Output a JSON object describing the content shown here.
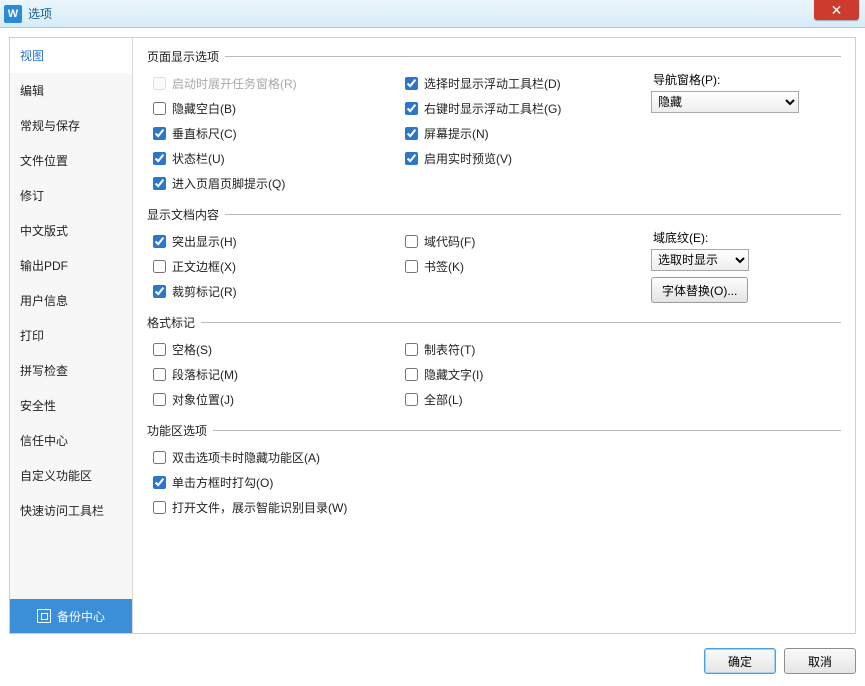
{
  "titlebar": {
    "title": "选项",
    "close": "✕",
    "app_icon_text": "W"
  },
  "sidebar": {
    "items": [
      "视图",
      "编辑",
      "常规与保存",
      "文件位置",
      "修订",
      "中文版式",
      "输出PDF",
      "用户信息",
      "打印",
      "拼写检查",
      "安全性",
      "信任中心",
      "自定义功能区",
      "快速访问工具栏"
    ],
    "selected_index": 0,
    "backup_center": "备份中心"
  },
  "groups": {
    "page_display": {
      "legend": "页面显示选项",
      "col_a": [
        {
          "label": "启动时展开任务窗格(R)",
          "checked": false,
          "disabled": true
        },
        {
          "label": "隐藏空白(B)",
          "checked": false
        },
        {
          "label": "垂直标尺(C)",
          "checked": true
        },
        {
          "label": "状态栏(U)",
          "checked": true
        },
        {
          "label": "进入页眉页脚提示(Q)",
          "checked": true
        }
      ],
      "col_b": [
        {
          "label": "选择时显示浮动工具栏(D)",
          "checked": true
        },
        {
          "label": "右键时显示浮动工具栏(G)",
          "checked": true
        },
        {
          "label": "屏幕提示(N)",
          "checked": true
        },
        {
          "label": "启用实时预览(V)",
          "checked": true
        }
      ],
      "nav_label": "导航窗格(P):",
      "nav_value": "隐藏"
    },
    "doc_content": {
      "legend": "显示文档内容",
      "col_a": [
        {
          "label": "突出显示(H)",
          "checked": true
        },
        {
          "label": "正文边框(X)",
          "checked": false
        },
        {
          "label": "裁剪标记(R)",
          "checked": true
        }
      ],
      "col_b": [
        {
          "label": "域代码(F)",
          "checked": false
        },
        {
          "label": "书签(K)",
          "checked": false
        }
      ],
      "shading_label": "域底纹(E):",
      "shading_value": "选取时显示",
      "font_sub_btn": "字体替换(O)..."
    },
    "format_marks": {
      "legend": "格式标记",
      "col_a": [
        {
          "label": "空格(S)",
          "checked": false
        },
        {
          "label": "段落标记(M)",
          "checked": false
        },
        {
          "label": "对象位置(J)",
          "checked": false
        }
      ],
      "col_b": [
        {
          "label": "制表符(T)",
          "checked": false
        },
        {
          "label": "隐藏文字(I)",
          "checked": false
        },
        {
          "label": "全部(L)",
          "checked": false
        }
      ]
    },
    "ribbon": {
      "legend": "功能区选项",
      "items": [
        {
          "label": "双击选项卡时隐藏功能区(A)",
          "checked": false
        },
        {
          "label": "单击方框时打勾(O)",
          "checked": true
        },
        {
          "label": "打开文件，展示智能识别目录(W)",
          "checked": false
        }
      ]
    }
  },
  "buttons": {
    "ok": "确定",
    "cancel": "取消"
  }
}
